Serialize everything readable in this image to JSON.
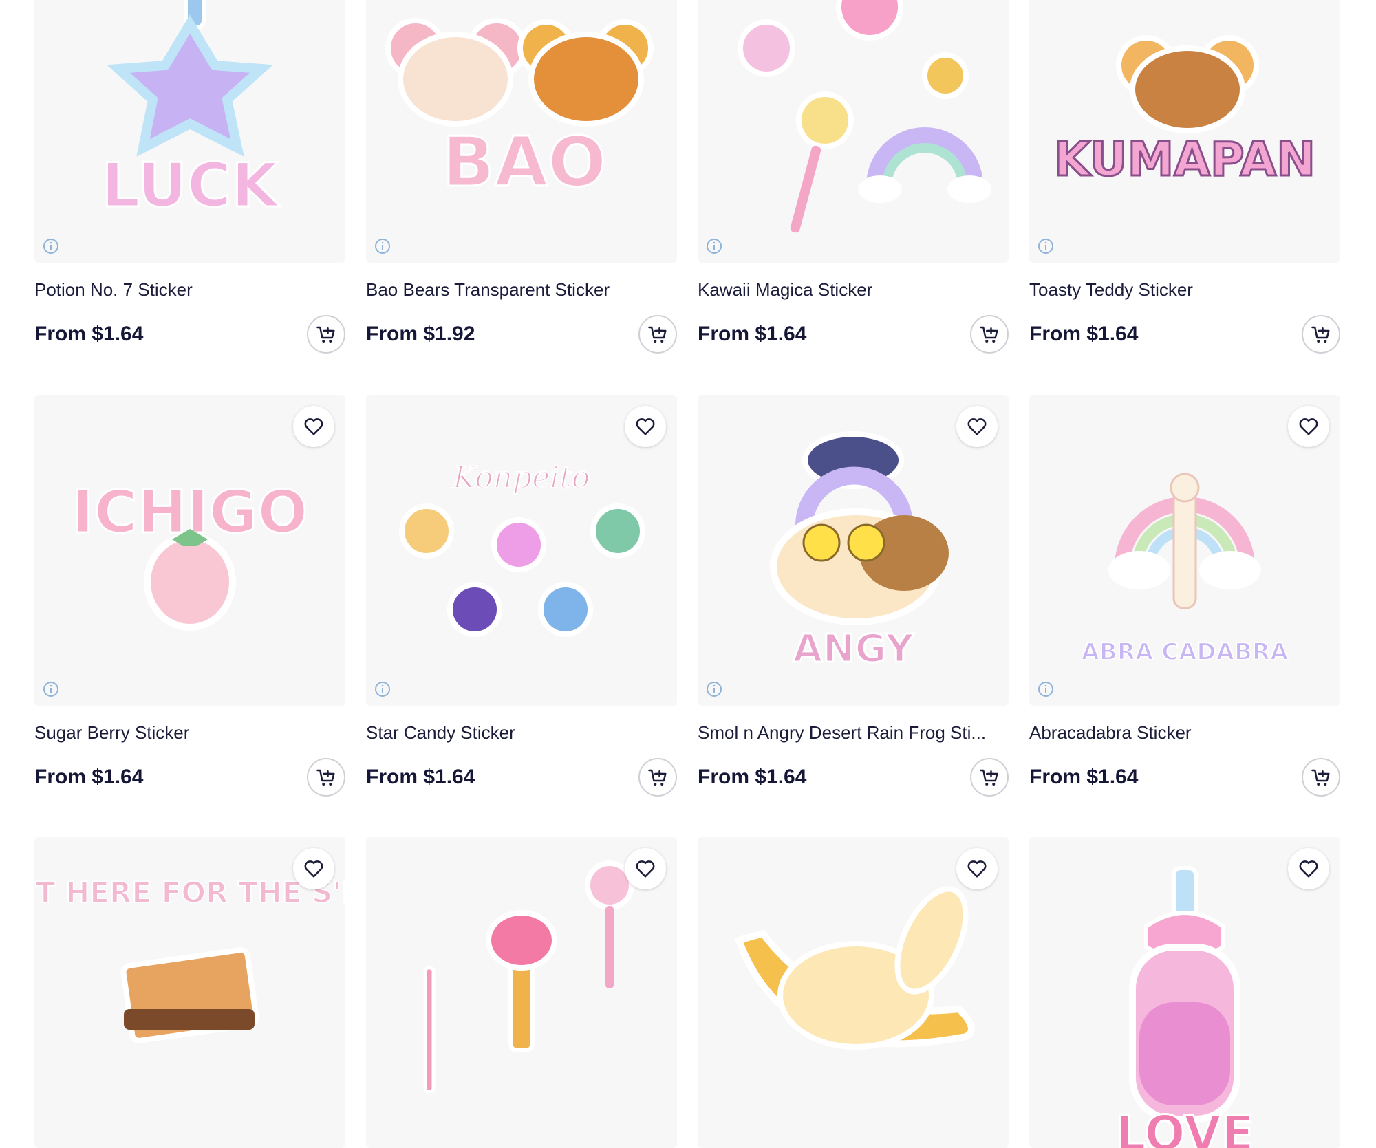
{
  "products": [
    {
      "title": "Potion No. 7 Sticker",
      "price": "From $1.64",
      "art": "potion-star-bottle-luck",
      "art_text": "LUCK"
    },
    {
      "title": "Bao Bears Transparent Sticker",
      "price": "From $1.92",
      "art": "bao-bears",
      "art_text": "BAO"
    },
    {
      "title": "Kawaii Magica Sticker",
      "price": "From $1.64",
      "art": "magical-items-rainbow",
      "art_text": ""
    },
    {
      "title": "Toasty Teddy Sticker",
      "price": "From $1.64",
      "art": "toast-bear-kumapan",
      "art_text": "KUMAPAN"
    },
    {
      "title": "Sugar Berry Sticker",
      "price": "From $1.64",
      "art": "strawberry-ichigo",
      "art_text": "ICHIGO"
    },
    {
      "title": "Star Candy Sticker",
      "price": "From $1.64",
      "art": "konpeito-candies",
      "art_text": "Konpeito"
    },
    {
      "title": "Smol n Angry Desert Rain Frog Sti...",
      "price": "From $1.64",
      "art": "angry-frog-rainbow",
      "art_text": "ANGY"
    },
    {
      "title": "Abracadabra Sticker",
      "price": "From $1.64",
      "art": "magic-wand-rainbow",
      "art_text": "ABRA CADABRA"
    },
    {
      "title": "",
      "price": "",
      "art": "smores-sandwich",
      "art_text": "I'M JUST HERE FOR THE S'MORES"
    },
    {
      "title": "",
      "price": "",
      "art": "magical-weapons",
      "art_text": ""
    },
    {
      "title": "",
      "price": "",
      "art": "banana-bunny",
      "art_text": ""
    },
    {
      "title": "",
      "price": "",
      "art": "love-potion-bottle",
      "art_text": "LOVE"
    }
  ],
  "icons": {
    "favorite": "heart-outline-icon",
    "cart": "add-to-cart-icon",
    "info": "info-icon"
  },
  "colors": {
    "text": "#1b1c3a",
    "tile_bg": "#f7f7f8",
    "info_blue": "#8fb3d9",
    "accent_pink": "#f7a8c8"
  }
}
